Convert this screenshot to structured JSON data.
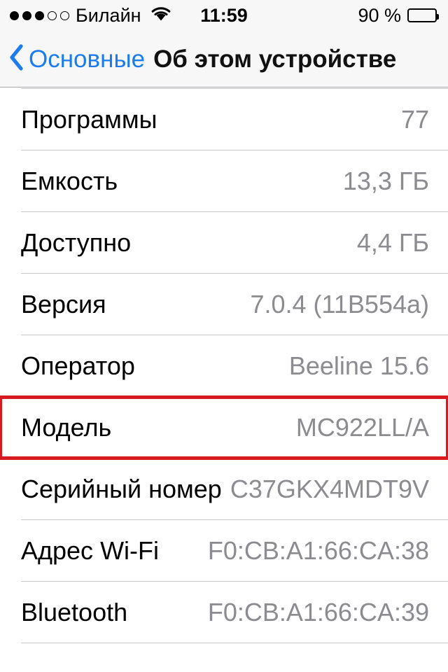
{
  "status_bar": {
    "signal_dots_filled": 3,
    "signal_dots_empty": 2,
    "carrier": "Билайн",
    "wifi_icon": "wifi-icon",
    "time": "11:59",
    "battery_percent": "90 %",
    "battery_level": 90,
    "battery_icon": "battery-icon"
  },
  "nav_bar": {
    "back_icon": "chevron-left-icon",
    "back_label": "Основные",
    "title": "Об этом устройстве"
  },
  "colors": {
    "accent_blue": "#1a7ced",
    "value_gray": "#8b8b90",
    "separator": "#c8c7cc",
    "chrome_bg": "#f7f7f7",
    "highlight_red": "#d71920"
  },
  "list": {
    "rows": [
      {
        "label": "Программы",
        "value": "77",
        "highlighted": false
      },
      {
        "label": "Емкость",
        "value": "13,3 ГБ",
        "highlighted": false
      },
      {
        "label": "Доступно",
        "value": "4,4 ГБ",
        "highlighted": false
      },
      {
        "label": "Версия",
        "value": "7.0.4 (11B554a)",
        "highlighted": false
      },
      {
        "label": "Оператор",
        "value": "Beeline 15.6",
        "highlighted": false
      },
      {
        "label": "Модель",
        "value": "MC922LL/A",
        "highlighted": true
      },
      {
        "label": "Серийный номер",
        "value": "C37GKX4MDT9V",
        "highlighted": false
      },
      {
        "label": "Адрес Wi-Fi",
        "value": "F0:CB:A1:66:CA:38",
        "highlighted": false
      },
      {
        "label": "Bluetooth",
        "value": "F0:CB:A1:66:CA:39",
        "highlighted": false
      }
    ]
  }
}
